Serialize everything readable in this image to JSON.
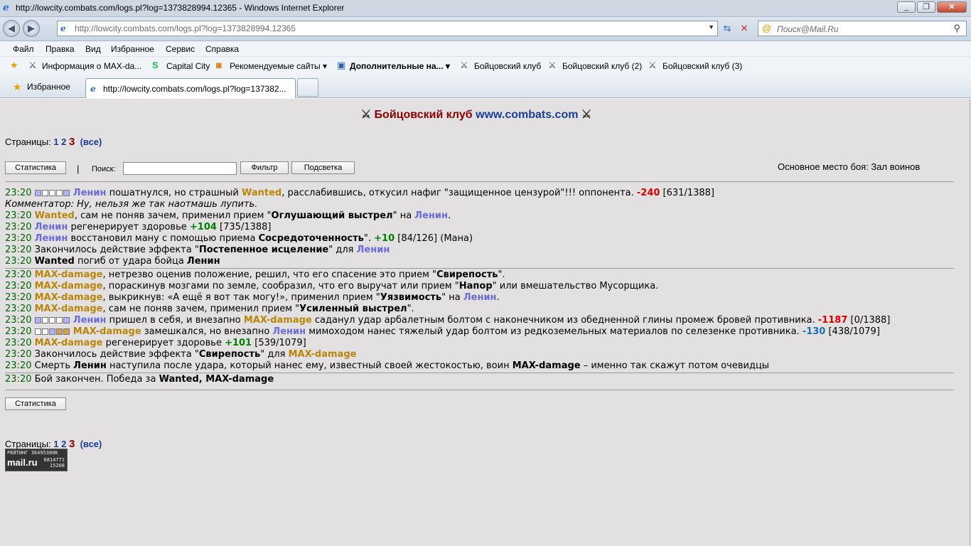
{
  "window": {
    "title": "http://lowcity.combats.com/logs.pl?log=1373828994.12365 - Windows Internet Explorer",
    "buttons": [
      "_",
      "❐",
      "✕"
    ]
  },
  "address": {
    "url": "http://lowcity.combats.com/logs.pl?log=1373828994.12365"
  },
  "search": {
    "placeholder": "Поиск@Mail.Ru"
  },
  "menu": [
    "Файл",
    "Правка",
    "Вид",
    "Избранное",
    "Сервис",
    "Справка"
  ],
  "favorites": [
    "Информация о MAX-da...",
    "Capital City",
    "Рекомендуемые сайты ▾",
    "Дополнительные на... ▾",
    "Бойцовский клуб",
    "Бойцовский клуб (2)",
    "Бойцовский клуб (3)"
  ],
  "tabs": {
    "fav_label": "Избранное",
    "active_tab": "http://lowcity.combats.com/logs.pl?log=137382..."
  },
  "page": {
    "header": {
      "club": "Бойцовский клуб",
      "site": "www.combats.com"
    },
    "pages_label": "Страницы:",
    "pages": [
      "1",
      "2"
    ],
    "current_page": "3",
    "all": "(все)",
    "btn_stats": "Статистика",
    "sep": "|",
    "search_label": "Поиск:",
    "btn_filter": "Фильтр",
    "btn_highlight": "Подсветка",
    "place": "Основное место боя: Зал воинов",
    "time_h": "23",
    "time_m": "20",
    "l1": {
      "who": "Ленин",
      "a": " пошатнулся, но страшный ",
      "who2": "Wanted",
      "b": ", расслабившись, откусил нафиг \"защищенное цензурой\"!!! оппонента. ",
      "dmg": "-240",
      "hp": " [631/1388]"
    },
    "comment": "Комментатор: Ну, нельзя же так наотмашь лупить.",
    "l2": {
      "who": "Wanted",
      "a": ", сам не поняв зачем, применил прием \"",
      "skill": "Оглушающий выстрел",
      "b": "\" на ",
      "who2": "Ленин",
      "c": "."
    },
    "l3": {
      "who": "Ленин",
      "a": " регенерирует здоровье ",
      "hp": "+104",
      "b": " [735/1388]"
    },
    "l4": {
      "who": "Ленин",
      "a": " восстановил ману с помощью приема ",
      "skill": "Сосредоточенность",
      "b": "\". ",
      "mana": "+10",
      "c": " [84/126] (Мана)"
    },
    "l5": {
      "a": "Закончилось действие эффекта \"",
      "skill": "Постепенное исцеление",
      "b": "\" для ",
      "who": "Ленин"
    },
    "l6": {
      "who": "Wanted",
      "a": " погиб от удара бойца ",
      "who2": "Ленин"
    },
    "l7": {
      "who": "MAX-damage",
      "a": ", нетрезво оценив положение, решил, что его спасение это прием \"",
      "skill": "Свирепость",
      "b": "\"."
    },
    "l8": {
      "who": "MAX-damage",
      "a": ", пораскинув мозгами по земле, сообразил, что его выручат или прием \"",
      "skill": "Напор",
      "b": "\" или вмешательство Мусорщика."
    },
    "l9": {
      "who": "MAX-damage",
      "a": ", выкрикнув: «А ещё я вот так могу!», применил прием \"",
      "skill": "Уязвимость",
      "b": "\" на ",
      "who2": "Ленин",
      "c": "."
    },
    "l10": {
      "who": "MAX-damage",
      "a": ", сам не поняв зачем, применил прием \"",
      "skill": "Усиленный выстрел",
      "b": "\"."
    },
    "l11": {
      "who": "Ленин",
      "a": " пришел в себя, и внезапно ",
      "who2": "MAX-damage",
      "b": " саданул удар арбалетным болтом с наконечником из обедненной глины промеж бровей противника. ",
      "dmg": "-1187",
      "hp": " [0/1388]"
    },
    "l12": {
      "who": "MAX-damage",
      "a": " замешкался, но внезапно ",
      "who2": "Ленин",
      "b": " мимоходом нанес тяжелый удар болтом из редкоземельных материалов по селезенке противника. ",
      "dmg": "-130",
      "hp": " [438/1079]"
    },
    "l13": {
      "who": "MAX-damage",
      "a": " регенерирует здоровье ",
      "hp": "+101",
      "b": " [539/1079]"
    },
    "l14": {
      "a": "Закончилось действие эффекта \"",
      "skill": "Свирепость",
      "b": "\" для ",
      "who": "MAX-damage"
    },
    "l15": {
      "a": "Смерть ",
      "who": "Ленин",
      "b": " наступила после удара, который нанес ему, известный своей жестокостью, воин ",
      "who2": "MAX-damage",
      "c": " – именно так скажут потом очевидцы"
    },
    "l16": {
      "a": "Бой закончен. Победа за ",
      "who": "Wanted, MAX-damage"
    },
    "counter": {
      "rating": "РЕЙТИНГ 36495380К",
      "logo": "mail.ru",
      "n1": "6814771",
      "n2": "15208"
    }
  }
}
